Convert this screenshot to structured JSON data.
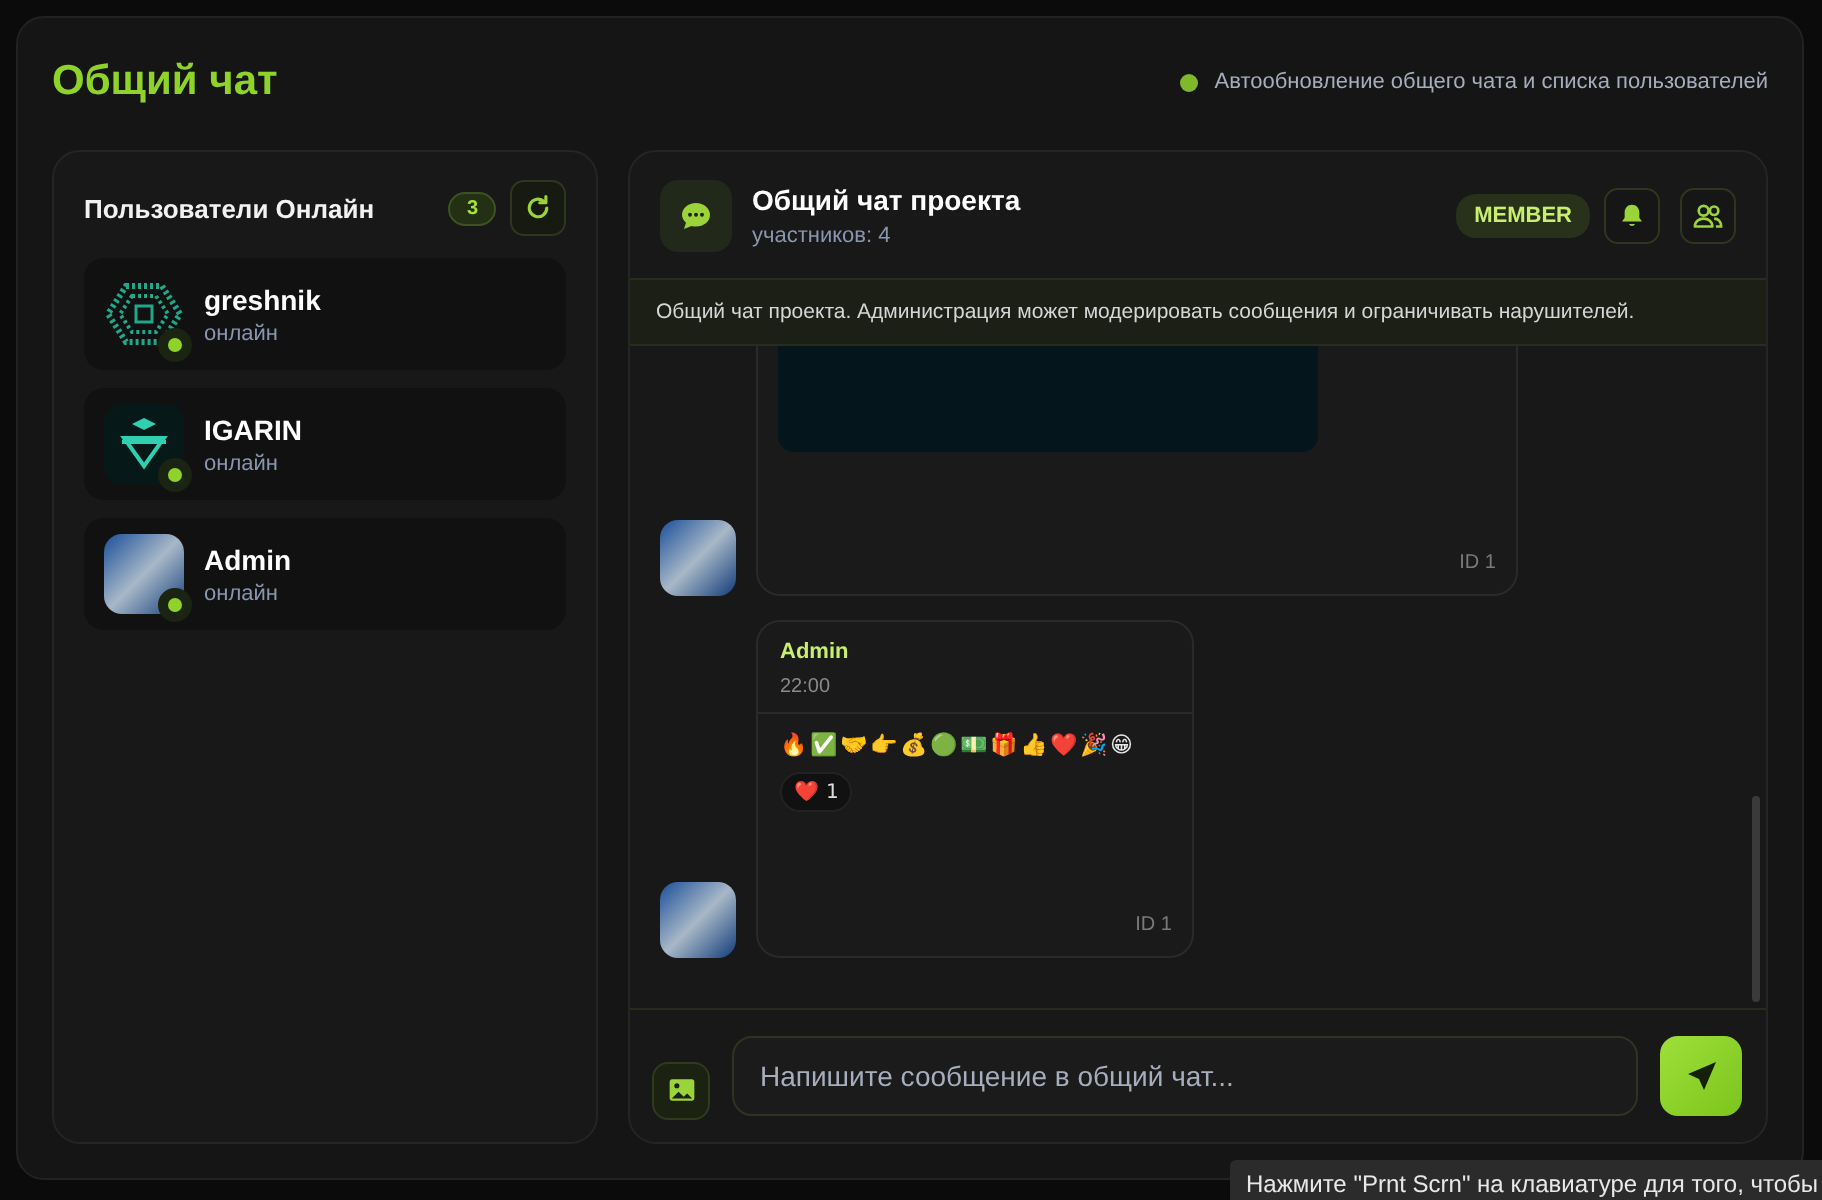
{
  "page_title": "Общий чат",
  "autoupdate": {
    "text": "Автообновление общего чата и списка пользователей",
    "active": true
  },
  "users_panel": {
    "title": "Пользователи Онлайн",
    "count": "3",
    "users": [
      {
        "name": "greshnik",
        "status": "онлайн",
        "online": true,
        "kind": "hexagon"
      },
      {
        "name": "IGARIN",
        "status": "онлайн",
        "online": true,
        "kind": "emblem"
      },
      {
        "name": "Admin",
        "status": "онлайн",
        "online": true,
        "kind": "photo"
      }
    ]
  },
  "chat": {
    "title": "Общий чат проекта",
    "subtitle": "участников: 4",
    "role_badge": "MEMBER",
    "notice": "Общий чат проекта. Администрация может модерировать сообщения и ограничивать нарушителей.",
    "messages": [
      {
        "kind": "image",
        "id_label": "ID 1"
      },
      {
        "kind": "text",
        "author": "Admin",
        "time": "22:00",
        "text": "🔥✅🤝👉💰🟢💵🎁👍❤️🎉😁",
        "reactions": [
          {
            "emoji": "❤️",
            "count": "1"
          }
        ],
        "id_label": "ID 1"
      }
    ],
    "composer": {
      "placeholder": "Напишите сообщение в общий чат..."
    }
  },
  "tooltip": "Нажмите \"Prnt Scrn\" на клавиатуре для того, чтобы"
}
